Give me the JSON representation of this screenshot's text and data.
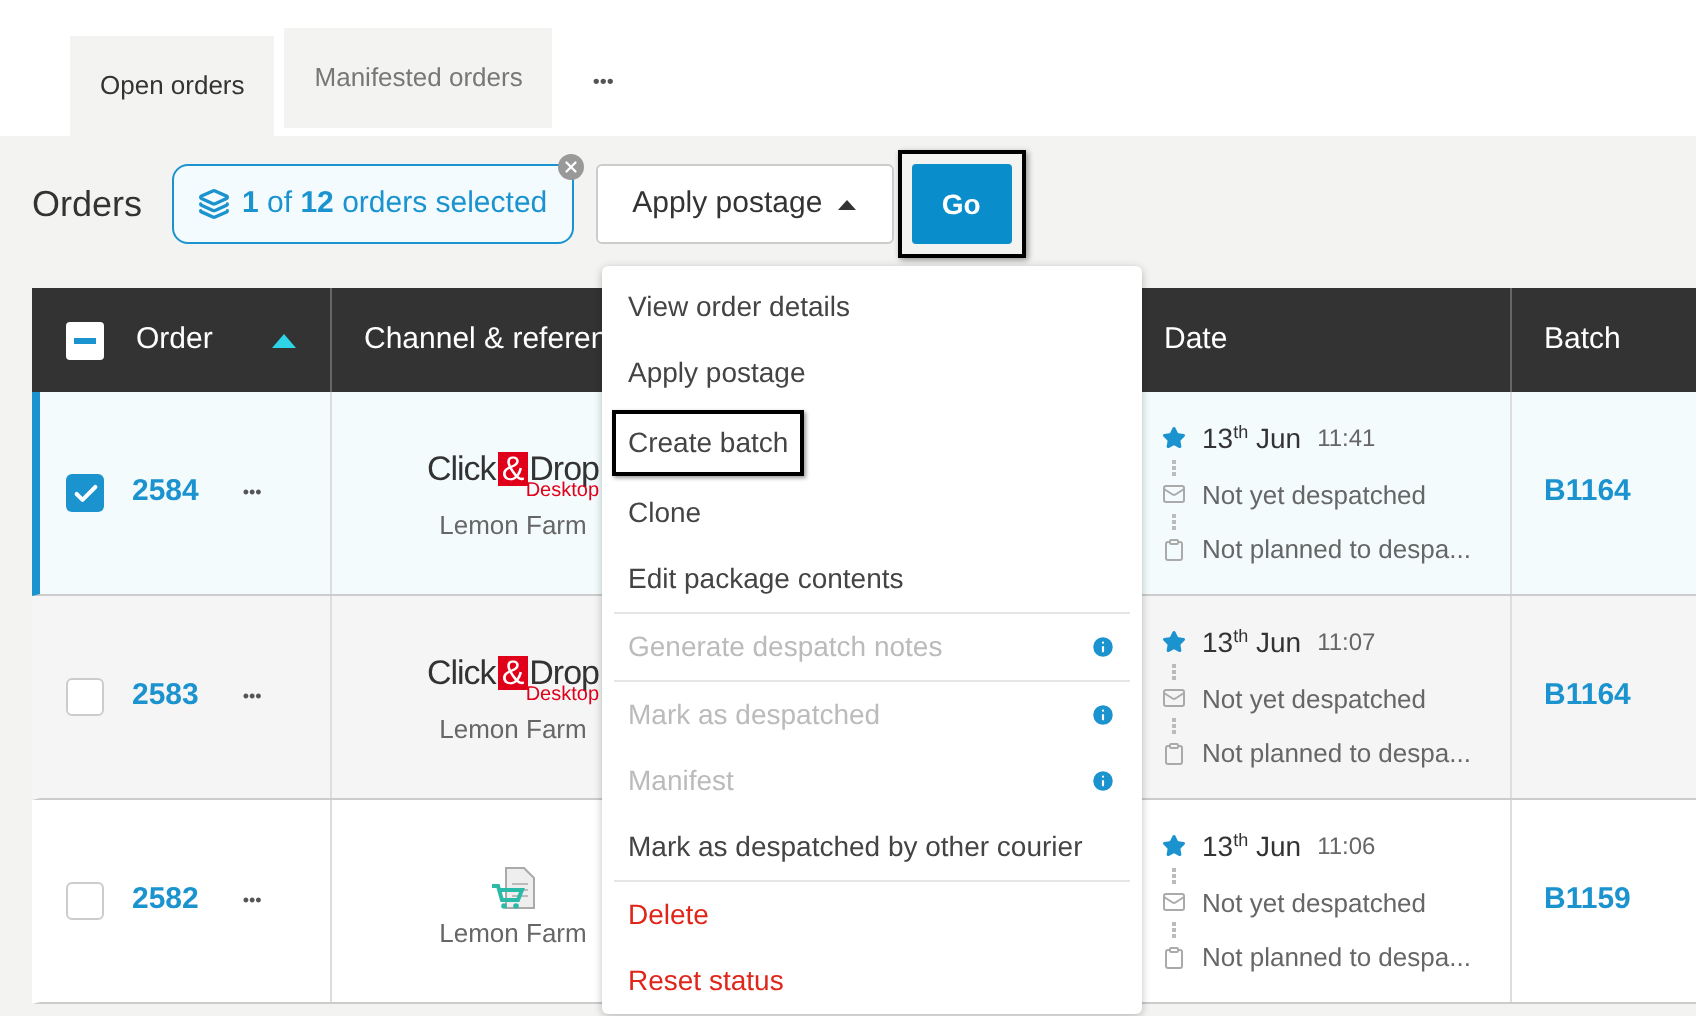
{
  "tabs": [
    {
      "label": "Open orders",
      "selected": true
    },
    {
      "label": "Manifested orders",
      "selected": false
    }
  ],
  "tabs_more": "•••",
  "toolbar": {
    "title": "Orders",
    "selection": "**1** of **12** orders selected",
    "action": "Apply postage",
    "go": "Go"
  },
  "table": {
    "select_all": {
      "indeterminate": true
    },
    "columns": [
      {
        "label": "Order",
        "sorted": true
      },
      {
        "label": "Channel & referen",
        "sorted": false
      },
      {
        "label": "Date",
        "sorted": false
      },
      {
        "label": "Batch",
        "sorted": false
      }
    ],
    "rows": [
      {
        "selected": true,
        "order": "2584",
        "more": "•••",
        "channel": {
          "kind": "click_drop",
          "click": "Click",
          "amp": "&",
          "drop": "Drop",
          "sub": "Desktop",
          "name": "Lemon Farm"
        },
        "date": "13$^{th}$ Jun",
        "time": "11:41",
        "despatch": "Not yet despatched",
        "plan": "Not planned to despa...",
        "batch": "B1164"
      },
      {
        "selected": false,
        "order": "2583",
        "more": "•••",
        "channel": {
          "kind": "click_drop",
          "click": "Click",
          "amp": "&",
          "drop": "Drop",
          "sub": "Desktop",
          "name": "Lemon Farm"
        },
        "date": "13$^{th}$ Jun",
        "time": "11:07",
        "despatch": "Not yet despatched",
        "plan": "Not planned to despa...",
        "batch": "B1164"
      },
      {
        "selected": false,
        "order": "2582",
        "more": "•••",
        "channel": {
          "kind": "cart_doc",
          "name": "Lemon Farm"
        },
        "date": "13$^{th}$ Jun",
        "time": "11:06",
        "despatch": "Not yet despatched",
        "plan": "Not planned to despa...",
        "batch": "B1159"
      }
    ]
  },
  "menu": [
    {
      "label": "View order details",
      "kind": "normal",
      "highlighted": false,
      "separator": false
    },
    {
      "label": "Apply postage",
      "kind": "normal",
      "highlighted": false,
      "separator": false
    },
    {
      "label": "Create batch",
      "kind": "normal",
      "highlighted": true,
      "separator": false
    },
    {
      "label": "Clone",
      "kind": "normal",
      "highlighted": false,
      "separator": false
    },
    {
      "label": "Edit package contents",
      "kind": "normal",
      "highlighted": false,
      "separator": false
    },
    {
      "label": "Generate despatch notes",
      "kind": "disabled",
      "highlighted": false,
      "separator": true
    },
    {
      "label": "Mark as despatched",
      "kind": "disabled",
      "highlighted": false,
      "separator": true
    },
    {
      "label": "Manifest",
      "kind": "disabled",
      "highlighted": false,
      "separator": false
    },
    {
      "label": "Mark as despatched by other courier",
      "kind": "normal",
      "highlighted": false,
      "separator": false
    },
    {
      "label": "Delete",
      "kind": "danger",
      "highlighted": false,
      "separator": true
    },
    {
      "label": "Reset status",
      "kind": "danger",
      "highlighted": false,
      "separator": false
    }
  ]
}
